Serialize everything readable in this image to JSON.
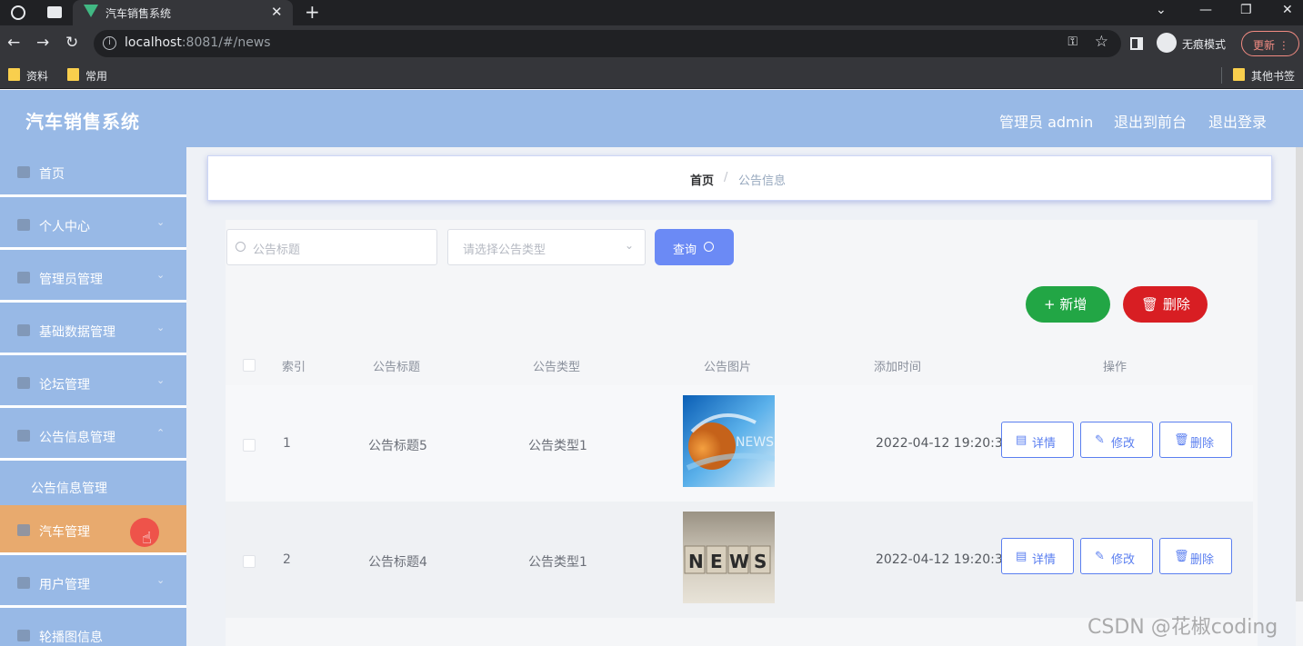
{
  "browser": {
    "tab_title": "汽车销售系统",
    "url_host": "localhost",
    "url_rest": ":8081/#/news",
    "incognito_label": "无痕模式",
    "update_label": "更新",
    "bookmarks": [
      "资料",
      "常用"
    ],
    "other_bookmarks": "其他书签"
  },
  "header": {
    "title": "汽车销售系统",
    "admin": "管理员 admin",
    "to_front": "退出到前台",
    "logout": "退出登录"
  },
  "sidebar": {
    "items": [
      {
        "label": "首页"
      },
      {
        "label": "个人中心"
      },
      {
        "label": "管理员管理"
      },
      {
        "label": "基础数据管理"
      },
      {
        "label": "论坛管理"
      },
      {
        "label": "公告信息管理"
      },
      {
        "label": "公告信息管理"
      },
      {
        "label": "汽车管理"
      },
      {
        "label": "用户管理"
      },
      {
        "label": "轮播图信息"
      }
    ]
  },
  "breadcrumb": {
    "home": "首页",
    "sep": "/",
    "current": "公告信息"
  },
  "search": {
    "title_placeholder": "公告标题",
    "type_placeholder": "请选择公告类型",
    "query_label": "查询"
  },
  "actions": {
    "add_label": "新增",
    "delete_label": "删除"
  },
  "table": {
    "headers": [
      "索引",
      "公告标题",
      "公告类型",
      "公告图片",
      "添加时间",
      "操作"
    ],
    "rows": [
      {
        "index": "1",
        "title": "公告标题5",
        "type": "公告类型1",
        "time": "2022-04-12 19:20:36",
        "image": "news-globe-image"
      },
      {
        "index": "2",
        "title": "公告标题4",
        "type": "公告类型1",
        "time": "2022-04-12 19:20:36",
        "image": "news-blocks-image"
      }
    ],
    "row_actions": {
      "detail": "详情",
      "edit": "修改",
      "delete": "删除"
    }
  },
  "watermark": "CSDN @花椒coding",
  "colors": {
    "header_bg": "#98b9e6",
    "active_menu": "#e8aa6e",
    "primary": "#6b8af5",
    "add": "#22a645",
    "danger": "#d81e23"
  }
}
